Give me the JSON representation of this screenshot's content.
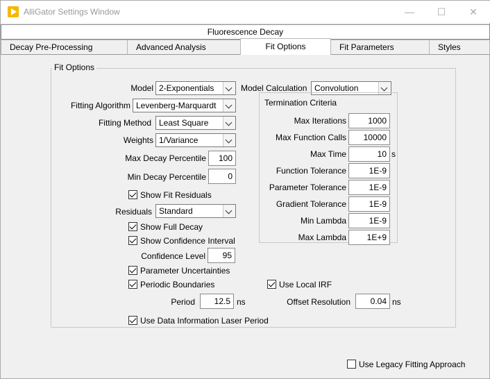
{
  "window": {
    "title": "AlliGator Settings Window",
    "minimize": "—",
    "maximize": "☐",
    "close": "✕"
  },
  "tabs": {
    "outer_tab": "Fluorescence Decay",
    "items": [
      "Decay Pre-Processing",
      "Advanced Analysis",
      "Fit Options",
      "Fit Parameters",
      "Styles"
    ],
    "active": "Fit Options"
  },
  "fit_options": {
    "group_title": "Fit Options",
    "model_label": "Model",
    "model_value": "2-Exponentials",
    "model_calc_label": "Model Calculation",
    "model_calc_value": "Convolution",
    "fitting_algorithm_label": "Fitting Algorithm",
    "fitting_algorithm_value": "Levenberg-Marquardt",
    "fitting_method_label": "Fitting Method",
    "fitting_method_value": "Least Square",
    "weights_label": "Weights",
    "weights_value": "1/Variance",
    "max_decay_label": "Max Decay Percentile",
    "max_decay_value": "100",
    "min_decay_label": "Min Decay Percentile",
    "min_decay_value": "0",
    "show_fit_residuals_label": "Show Fit Residuals",
    "residuals_label": "Residuals",
    "residuals_value": "Standard",
    "show_full_decay_label": "Show Full Decay",
    "show_confidence_label": "Show Confidence Interval",
    "confidence_level_label": "Confidence Level",
    "confidence_level_value": "95",
    "param_uncertainties_label": "Parameter Uncertainties",
    "periodic_boundaries_label": "Periodic Boundaries",
    "use_local_irf_label": "Use Local IRF",
    "period_label": "Period",
    "period_value": "12.5",
    "period_unit": "ns",
    "offset_resolution_label": "Offset Resolution",
    "offset_resolution_value": "0.04",
    "offset_resolution_unit": "ns",
    "use_laser_period_label": "Use Data Information Laser Period"
  },
  "termination": {
    "title": "Termination Criteria",
    "max_iterations_label": "Max Iterations",
    "max_iterations_value": "1000",
    "max_function_calls_label": "Max Function Calls",
    "max_function_calls_value": "10000",
    "max_time_label": "Max Time",
    "max_time_value": "10",
    "max_time_unit": "s",
    "function_tolerance_label": "Function Tolerance",
    "function_tolerance_value": "1E-9",
    "parameter_tolerance_label": "Parameter Tolerance",
    "parameter_tolerance_value": "1E-9",
    "gradient_tolerance_label": "Gradient Tolerance",
    "gradient_tolerance_value": "1E-9",
    "min_lambda_label": "Min Lambda",
    "min_lambda_value": "1E-9",
    "max_lambda_label": "Max Lambda",
    "max_lambda_value": "1E+9"
  },
  "footer": {
    "legacy_label": "Use Legacy Fitting Approach"
  },
  "checkboxes": {
    "show_fit_residuals": true,
    "show_full_decay": true,
    "show_confidence": true,
    "param_uncertainties": true,
    "periodic_boundaries": true,
    "use_local_irf": true,
    "use_laser_period": true,
    "legacy": false
  }
}
